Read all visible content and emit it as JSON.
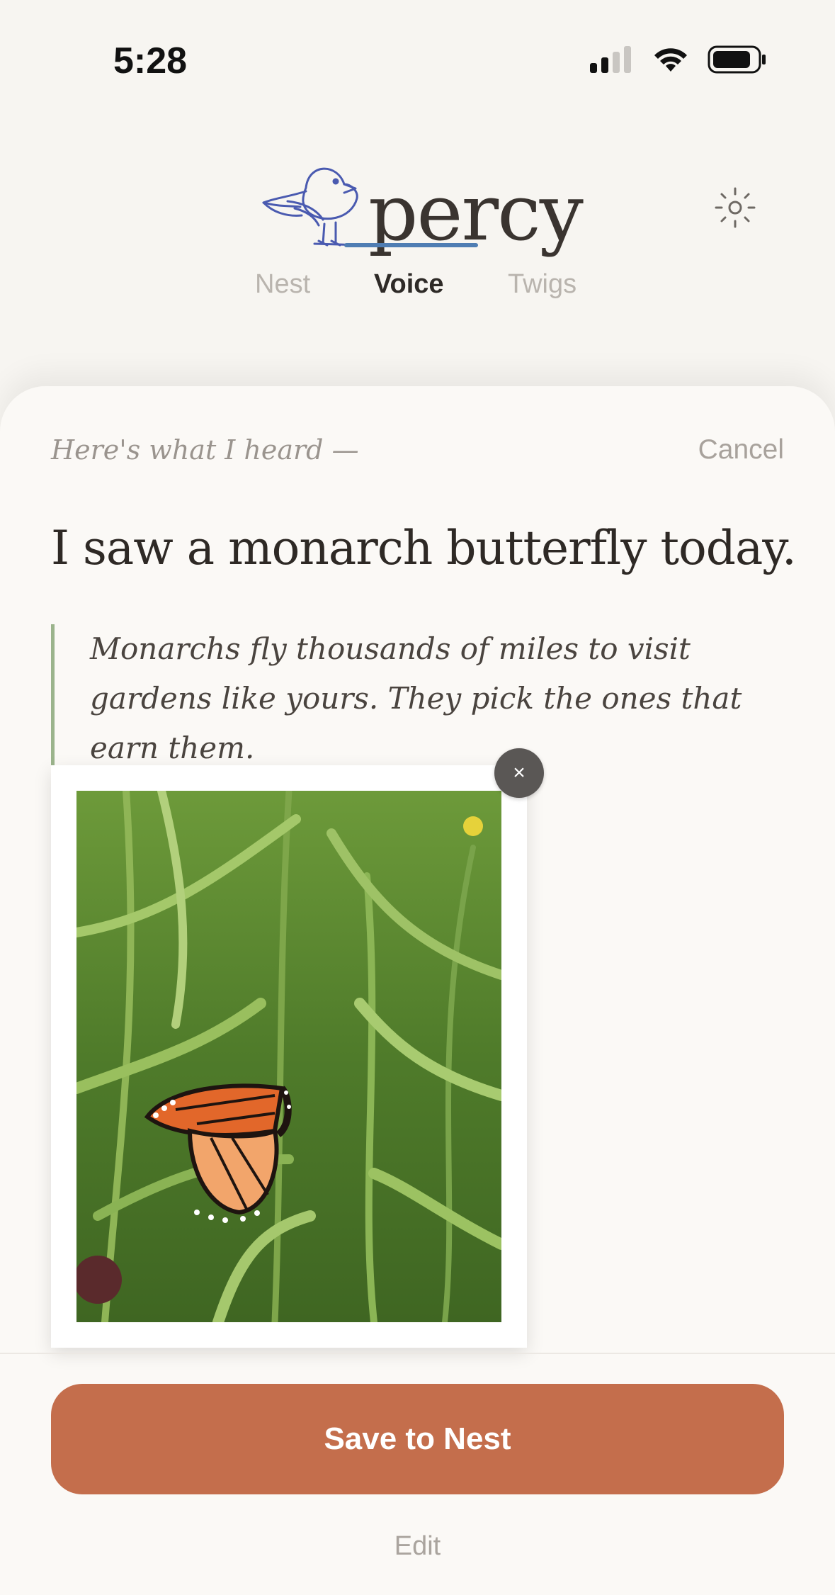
{
  "status_bar": {
    "time": "5:28",
    "icons": [
      "signal-icon",
      "wifi-icon",
      "battery-icon"
    ]
  },
  "header": {
    "logo_text": "percy",
    "logo_icon": "bird-icon",
    "settings_icon": "sun-settings-icon",
    "tabs": [
      {
        "label": "Nest",
        "active": false
      },
      {
        "label": "Voice",
        "active": true
      },
      {
        "label": "Twigs",
        "active": false
      }
    ]
  },
  "sheet": {
    "heard_label": "Here's what I heard —",
    "cancel_label": "Cancel",
    "transcript": "I saw a monarch butterfly today.",
    "quote": "Monarchs fly thousands of miles to visit gardens like yours. They pick the ones that earn them.",
    "remove_photo_label": "×"
  },
  "actions": {
    "save_label": "Save to Nest",
    "edit_label": "Edit"
  },
  "colors": {
    "background": "#f7f5f1",
    "accent_tab": "#4f7db3",
    "save_button": "#c46e4c",
    "quote_bar": "#9bb48c"
  }
}
